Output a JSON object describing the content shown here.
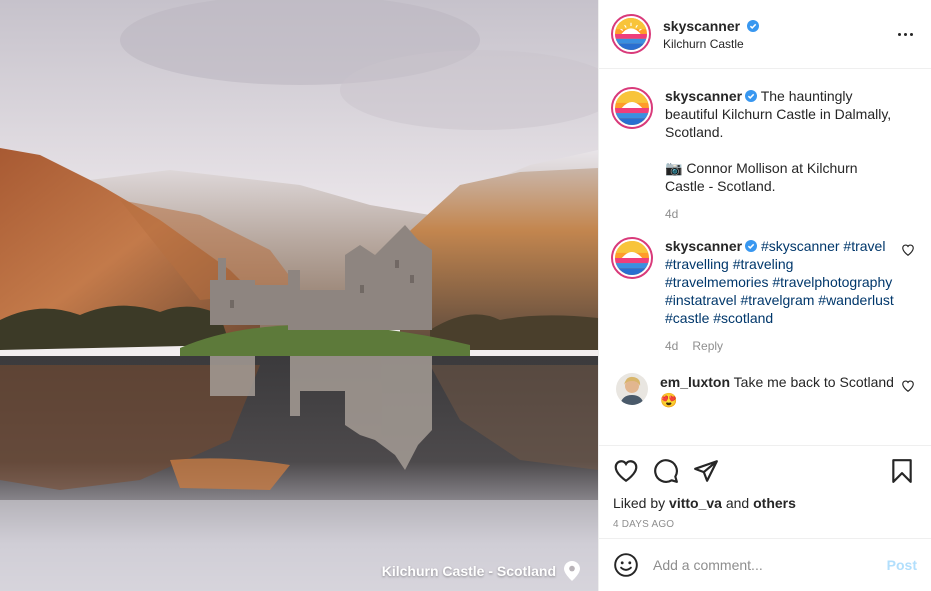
{
  "photo": {
    "location_caption": "Kilchurn Castle - Scotland",
    "pin_icon": "location-pin-icon"
  },
  "header": {
    "username": "skyscanner",
    "location": "Kilchurn Castle",
    "verified_icon": "verified-badge-icon",
    "more_icon": "more-options-icon"
  },
  "comments": [
    {
      "username": "skyscanner",
      "text": " The hauntingly beautiful Kilchurn Castle in Dalmally, Scotland.\n\n📷 Connor Mollison at Kilchurn Castle - Scotland.",
      "time": "4d"
    },
    {
      "username": "skyscanner",
      "tags": " #skyscanner #travel #travelling #traveling #travelmemories #travelphotography #instatravel #travelgram #wanderlust #castle #scotland",
      "time": "4d",
      "reply": "Reply"
    },
    {
      "username": "em_luxton",
      "text": " Take me back to Scotland 😍"
    }
  ],
  "actions": {
    "liked_prefix": "Liked by ",
    "liked_user": "vitto_va",
    "liked_and": " and ",
    "liked_others": "others",
    "date": "4 DAYS AGO"
  },
  "add_comment": {
    "placeholder": "Add a comment...",
    "post_label": "Post"
  },
  "colors": {
    "link": "#00376b",
    "muted": "#8e8e8e",
    "post_button": "#b2dffc",
    "verified": "#3897f0"
  }
}
